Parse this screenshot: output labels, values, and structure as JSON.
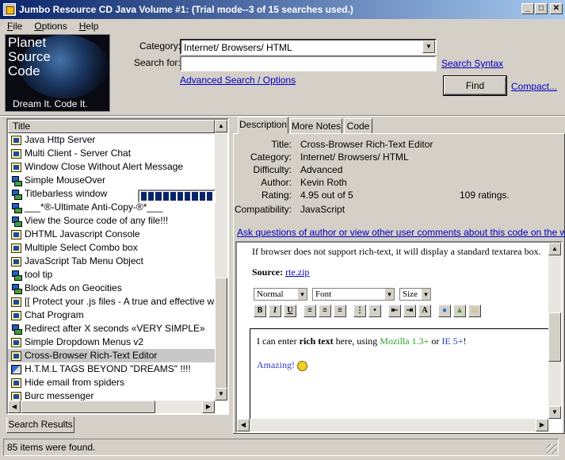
{
  "window": {
    "title": "Jumbo Resource CD Java Volume #1: (Trial mode--3 of 15 searches used.)",
    "min": "_",
    "max": "□",
    "close": "✕"
  },
  "menu": [
    "File",
    "Options",
    "Help"
  ],
  "logo": {
    "line1": "Planet",
    "line2": "Source",
    "line3": "Code",
    "tagline": "Dream It.  Code It."
  },
  "search": {
    "category_label": "Category:",
    "category_value": "Internet/ Browsers/ HTML",
    "searchfor_label": "Search for:",
    "searchfor_value": "",
    "syntax_link": "Search Syntax",
    "advanced_link": "Advanced Search / Options",
    "find_button": "Find",
    "compact_link": "Compact..."
  },
  "results": {
    "column_title": "Title",
    "items": [
      {
        "icon": "doc",
        "title": "Java Http Server"
      },
      {
        "icon": "doc",
        "title": "Multi Client - Server Chat"
      },
      {
        "icon": "doc",
        "title": "Window Close Without Alert Message"
      },
      {
        "icon": "net",
        "title": "Simple MouseOver"
      },
      {
        "icon": "net",
        "title": "Titlebarless window"
      },
      {
        "icon": "net",
        "title": "___*®-Ultimate Anti-Copy-®*___"
      },
      {
        "icon": "net",
        "title": "View the Source code of any file!!!"
      },
      {
        "icon": "doc",
        "title": "DHTML Javascript Console"
      },
      {
        "icon": "doc",
        "title": "Multiple Select Combo box"
      },
      {
        "icon": "doc",
        "title": "JavaScript Tab Menu Object"
      },
      {
        "icon": "net",
        "title": "tool tip"
      },
      {
        "icon": "net",
        "title": "Block Ads on Geocities"
      },
      {
        "icon": "doc",
        "title": "[[ Protect your .js files - A true and effective way"
      },
      {
        "icon": "doc",
        "title": "Chat Program"
      },
      {
        "icon": "net",
        "title": "Redirect after X seconds «VERY SIMPLE»"
      },
      {
        "icon": "doc",
        "title": "Simple Dropdown Menus v2"
      },
      {
        "icon": "doc",
        "title": "Cross-Browser Rich-Text Editor"
      },
      {
        "icon": "book",
        "title": "H.T.M.L TAGS BEYOND \"DREAMS\" !!!!"
      },
      {
        "icon": "doc",
        "title": "Hide email from spiders"
      },
      {
        "icon": "doc",
        "title": "Burc messenger"
      }
    ],
    "selected_index": 16,
    "tab_label": "Search Results"
  },
  "detail": {
    "tabs": [
      "Description",
      "More Notes",
      "Code"
    ],
    "fields": [
      {
        "key": "Title:",
        "value": "Cross-Browser Rich-Text Editor"
      },
      {
        "key": "Category:",
        "value": "Internet/ Browsers/ HTML"
      },
      {
        "key": "Difficulty:",
        "value": "Advanced"
      },
      {
        "key": "Author:",
        "value": "Kevin Roth"
      },
      {
        "key": "Rating:",
        "value": "4.95 out of 5"
      },
      {
        "key": "Compatibility:",
        "value": "JavaScript"
      }
    ],
    "rating_value": 4.95,
    "rating_max": 5,
    "rating_count": "109 ratings.",
    "ask_link": "Ask questions of author or view other user comments about this code on the web...",
    "preview": {
      "intro": "If browser does not support rich-text, it will display a standard textarea box.",
      "source_label": "Source:",
      "source_link": "rte.zip",
      "style_select": "Normal",
      "font_select": "Font",
      "size_select": "Size",
      "line1_a": "I can enter ",
      "line1_bold": "rich text",
      "line1_b": " here, using ",
      "line1_green": "Mozilla 1.3+",
      "line1_c": " or ",
      "line1_blue": "IE 5+",
      "line1_d": "!",
      "line2": "Amazing!"
    }
  },
  "status": "85 items were found.",
  "colors": {
    "title_start": "#0a246a",
    "title_end": "#a6caf0",
    "link": "#0000c0",
    "rating": "#0a246a"
  }
}
